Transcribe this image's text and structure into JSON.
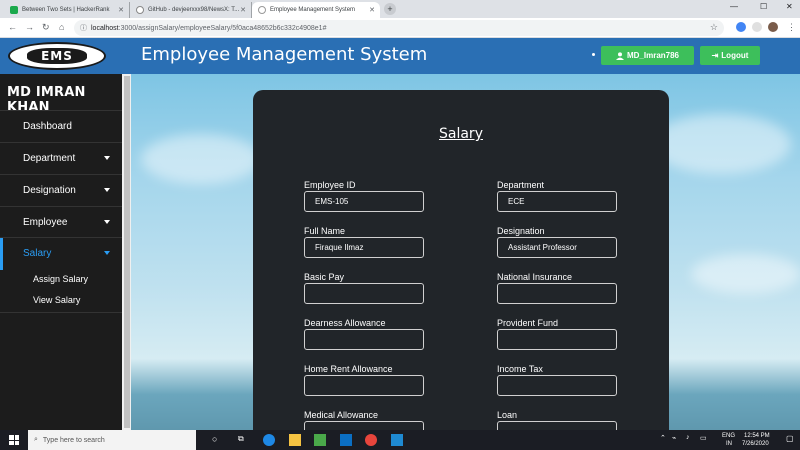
{
  "browser": {
    "tabs": [
      {
        "title": "Between Two Sets | HackerRank"
      },
      {
        "title": "GitHub - devjeerxxx98/NewsX: T..."
      },
      {
        "title": "Employee Management System"
      }
    ],
    "new_tab": "+",
    "url_host": "localhost",
    "url_path": ":3000/assignSalary/employeeSalary/5f0aca48652b6c332c4908e1#"
  },
  "header": {
    "logo_text": "EMS",
    "title": "Employee Management System",
    "user_button": "MD_Imran786",
    "logout_button": "Logout"
  },
  "sidebar": {
    "username": "MD IMRAN KHAN",
    "items": [
      {
        "label": "Dashboard",
        "has_caret": false
      },
      {
        "label": "Department",
        "has_caret": true
      },
      {
        "label": "Designation",
        "has_caret": true
      },
      {
        "label": "Employee",
        "has_caret": true
      },
      {
        "label": "Salary",
        "has_caret": true
      }
    ],
    "subitems": [
      {
        "label": "Assign Salary"
      },
      {
        "label": "View Salary"
      }
    ]
  },
  "form": {
    "title": "Salary",
    "fields": [
      {
        "label": "Employee ID",
        "value": "EMS-105"
      },
      {
        "label": "Department",
        "value": "ECE"
      },
      {
        "label": "Full Name",
        "value": "Firaque Ilmaz"
      },
      {
        "label": "Designation",
        "value": "Assistant Professor"
      },
      {
        "label": "Basic Pay",
        "value": ""
      },
      {
        "label": "National Insurance",
        "value": ""
      },
      {
        "label": "Dearness Allowance",
        "value": ""
      },
      {
        "label": "Provident Fund",
        "value": ""
      },
      {
        "label": "Home Rent Allowance",
        "value": ""
      },
      {
        "label": "Income Tax",
        "value": ""
      },
      {
        "label": "Medical Allowance",
        "value": ""
      },
      {
        "label": "Loan",
        "value": ""
      }
    ]
  },
  "taskbar": {
    "search_placeholder": "Type here to search",
    "lang": "ENG",
    "region": "IN",
    "time": "12:54 PM",
    "date": "7/26/2020"
  },
  "colors": {
    "header_bg": "#2a6fb4",
    "sidebar_bg": "#1c1c1c",
    "active_nav": "#2a9df4",
    "button_green": "#3dbf5b",
    "card_bg": "#212529"
  }
}
